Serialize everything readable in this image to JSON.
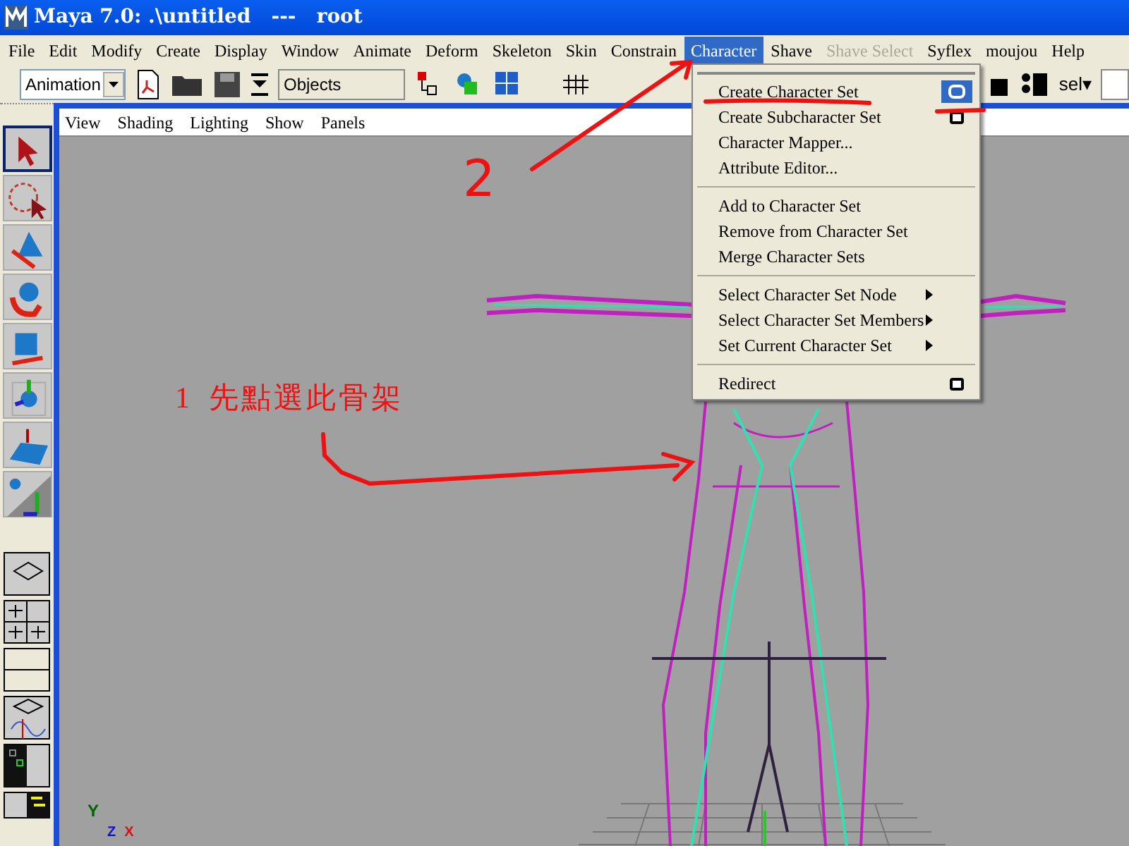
{
  "window": {
    "title": "Maya 7.0: .\\untitled   ---   root"
  },
  "menubar": [
    {
      "label": "File",
      "selected": false,
      "disabled": false
    },
    {
      "label": "Edit",
      "selected": false,
      "disabled": false
    },
    {
      "label": "Modify",
      "selected": false,
      "disabled": false
    },
    {
      "label": "Create",
      "selected": false,
      "disabled": false
    },
    {
      "label": "Display",
      "selected": false,
      "disabled": false
    },
    {
      "label": "Window",
      "selected": false,
      "disabled": false
    },
    {
      "label": "Animate",
      "selected": false,
      "disabled": false
    },
    {
      "label": "Deform",
      "selected": false,
      "disabled": false
    },
    {
      "label": "Skeleton",
      "selected": false,
      "disabled": false
    },
    {
      "label": "Skin",
      "selected": false,
      "disabled": false
    },
    {
      "label": "Constrain",
      "selected": false,
      "disabled": false
    },
    {
      "label": "Character",
      "selected": true,
      "disabled": false
    },
    {
      "label": "Shave",
      "selected": false,
      "disabled": false
    },
    {
      "label": "Shave Select",
      "selected": false,
      "disabled": true
    },
    {
      "label": "Syflex",
      "selected": false,
      "disabled": false
    },
    {
      "label": "moujou",
      "selected": false,
      "disabled": false
    },
    {
      "label": "Help",
      "selected": false,
      "disabled": false
    }
  ],
  "toolbar": {
    "mode": "Animation",
    "selection_field": "Objects",
    "sel_button": "sel▾"
  },
  "toolbox": [
    {
      "selected": true
    },
    {
      "selected": false
    },
    {
      "selected": false
    },
    {
      "selected": false
    },
    {
      "selected": false
    },
    {
      "selected": false
    },
    {
      "selected": false
    },
    {
      "selected": false
    }
  ],
  "viewport": {
    "menu": [
      "View",
      "Shading",
      "Lighting",
      "Show",
      "Panels"
    ],
    "axis_labels": [
      "Y",
      "Z",
      "X"
    ]
  },
  "character_menu": [
    [
      {
        "label": "Create Character Set",
        "kind": "option_box_active"
      },
      {
        "label": "Create Subcharacter Set",
        "kind": "option_box"
      },
      {
        "label": "Character Mapper...",
        "kind": "plain"
      },
      {
        "label": "Attribute Editor...",
        "kind": "plain"
      }
    ],
    [
      {
        "label": "Add to Character Set",
        "kind": "plain"
      },
      {
        "label": "Remove from Character Set",
        "kind": "plain"
      },
      {
        "label": "Merge Character Sets",
        "kind": "plain"
      }
    ],
    [
      {
        "label": "Select Character Set Node",
        "kind": "submenu"
      },
      {
        "label": "Select Character Set Members",
        "kind": "submenu"
      },
      {
        "label": "Set Current Character Set",
        "kind": "submenu"
      }
    ],
    [
      {
        "label": "Redirect",
        "kind": "option_box"
      }
    ]
  ],
  "annotations": {
    "step2": "2",
    "step1_number": "1",
    "step1_text": "先點選此骨架"
  }
}
